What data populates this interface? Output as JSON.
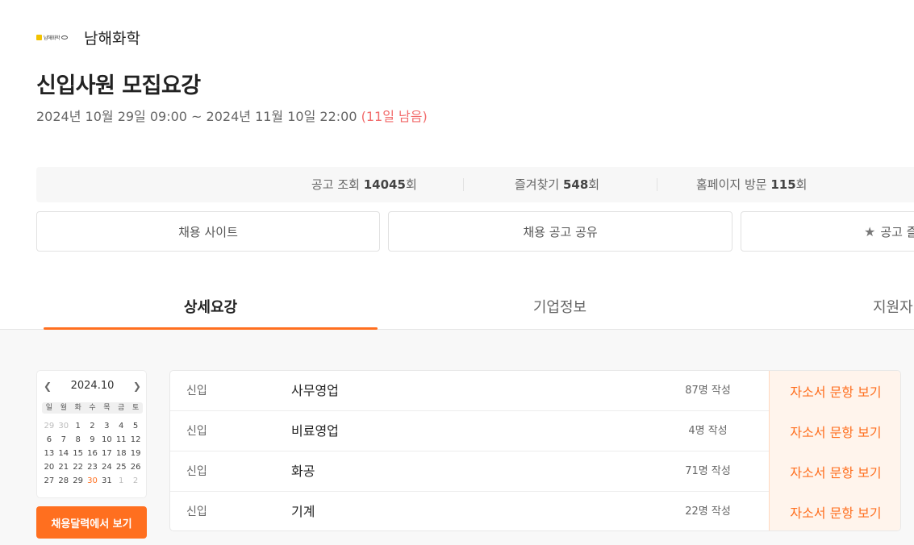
{
  "company": {
    "logo_text": "남해화학",
    "name": "남해화학"
  },
  "posting": {
    "title": "신입사원 모집요강",
    "period": "2024년 10월 29일 09:00 ~ 2024년 11월 10일 22:00",
    "remaining": "(11일 남음)"
  },
  "stats": [
    {
      "label": "공고 조회",
      "value": "14045",
      "unit": "회"
    },
    {
      "label": "즐겨찾기",
      "value": "548",
      "unit": "회"
    },
    {
      "label": "홈페이지 방문",
      "value": "115",
      "unit": "회"
    }
  ],
  "actions": {
    "site": "채용 사이트",
    "share": "채용 공고 공유",
    "favorite": "공고 즐"
  },
  "tabs": [
    "상세요강",
    "기업정보",
    "지원자"
  ],
  "calendar": {
    "month_label": "2024.10",
    "prev_icon": "chevron-left-icon",
    "next_icon": "chevron-right-icon",
    "weekdays": [
      "일",
      "월",
      "화",
      "수",
      "목",
      "금",
      "토"
    ],
    "days": [
      {
        "d": "29",
        "muted": true
      },
      {
        "d": "30",
        "muted": true
      },
      {
        "d": "1"
      },
      {
        "d": "2"
      },
      {
        "d": "3"
      },
      {
        "d": "4"
      },
      {
        "d": "5"
      },
      {
        "d": "6"
      },
      {
        "d": "7"
      },
      {
        "d": "8"
      },
      {
        "d": "9"
      },
      {
        "d": "10"
      },
      {
        "d": "11"
      },
      {
        "d": "12"
      },
      {
        "d": "13"
      },
      {
        "d": "14"
      },
      {
        "d": "15"
      },
      {
        "d": "16"
      },
      {
        "d": "17"
      },
      {
        "d": "18"
      },
      {
        "d": "19"
      },
      {
        "d": "20"
      },
      {
        "d": "21"
      },
      {
        "d": "22"
      },
      {
        "d": "23"
      },
      {
        "d": "24"
      },
      {
        "d": "25"
      },
      {
        "d": "26"
      },
      {
        "d": "27"
      },
      {
        "d": "28"
      },
      {
        "d": "29"
      },
      {
        "d": "30",
        "highlight": true
      },
      {
        "d": "31"
      },
      {
        "d": "1",
        "muted": true
      },
      {
        "d": "2",
        "muted": true
      }
    ],
    "button_label": "채용달력에서 보기"
  },
  "jobs": [
    {
      "type": "신입",
      "field": "사무영업",
      "count": "87명 작성",
      "button": "자소서 문항 보기"
    },
    {
      "type": "신입",
      "field": "비료영업",
      "count": "4명 작성",
      "button": "자소서 문항 보기"
    },
    {
      "type": "신입",
      "field": "화공",
      "count": "71명 작성",
      "button": "자소서 문항 보기"
    },
    {
      "type": "신입",
      "field": "기계",
      "count": "22명 작성",
      "button": "자소서 문항 보기"
    }
  ],
  "colors": {
    "accent": "#ff6f1f",
    "remaining": "#f26b6b"
  }
}
